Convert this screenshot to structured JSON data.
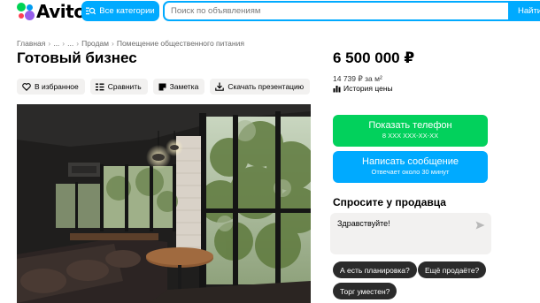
{
  "header": {
    "logo_text": "Avito",
    "categories_label": "Все категории",
    "search_placeholder": "Поиск по объявлениям",
    "search_value": "",
    "find_label": "Найти",
    "accent_color": "#00aaff"
  },
  "breadcrumbs": [
    "Главная",
    "...",
    "...",
    "Продам",
    "Помещение общественного питания"
  ],
  "listing": {
    "title": "Готовый бизнес",
    "actions": [
      {
        "label": "В избранное",
        "icon": "heart-icon"
      },
      {
        "label": "Сравнить",
        "icon": "compare-icon"
      },
      {
        "label": "Заметка",
        "icon": "note-icon"
      },
      {
        "label": "Скачать презентацию",
        "icon": "download-icon"
      }
    ],
    "photo_icon": "restaurant-interior-photo"
  },
  "sidebar": {
    "price": "6 500 000 ₽",
    "price_per_m2": "14 739 ₽ за м²",
    "price_history": "История цены",
    "phone_button": {
      "label": "Показать телефон",
      "sub": "8 XXX XXX-XX-XX",
      "color": "#02d15c"
    },
    "message_button": {
      "label": "Написать сообщение",
      "sub": "Отвечает около 30 минут",
      "color": "#00aaff"
    },
    "ask_title": "Спросите у продавца",
    "ask_text": "Здравствуйте!",
    "quick_questions": [
      "А есть планировка?",
      "Ещё продаёте?",
      "Торг уместен?"
    ]
  }
}
